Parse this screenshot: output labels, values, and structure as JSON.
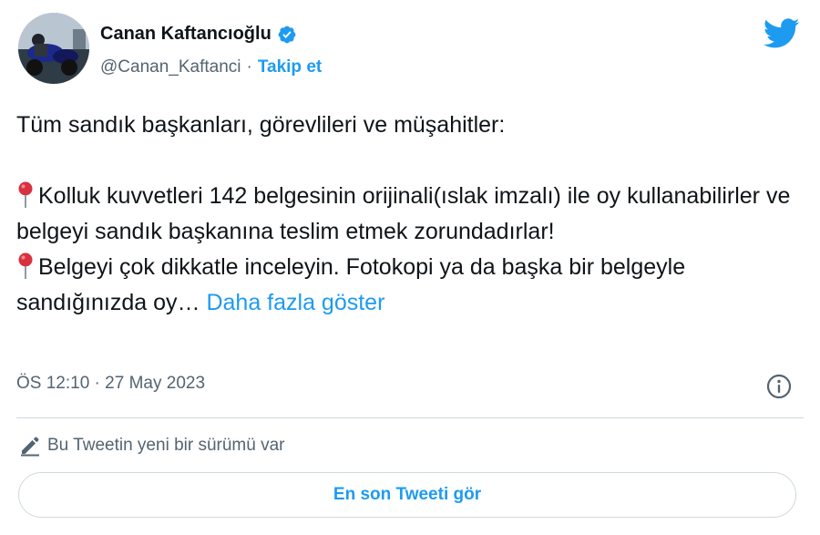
{
  "author": {
    "display_name": "Canan Kaftancıoğlu",
    "handle": "@Canan_Kaftanci",
    "separator": "·",
    "follow_label": "Takip et"
  },
  "icons": {
    "verified": "verified-badge-icon",
    "brand": "twitter-bird-icon",
    "pin": "round-pushpin-icon",
    "info": "info-icon",
    "edit": "pencil-icon"
  },
  "colors": {
    "accent": "#1d9bf0",
    "text": "#0f1419",
    "secondary": "#536471",
    "border": "#cfd9de",
    "pin_red": "#d9313f"
  },
  "tweet": {
    "line1": "Tüm sandık başkanları, görevlileri ve müşahitler:",
    "para2": "Kolluk kuvvetleri 142 belgesinin orijinali(ıslak imzalı) ile oy kullanabilirler ve belgeyi sandık başkanına teslim etmek zorundadırlar!",
    "para3": "Belgeyi çok dikkatle inceleyin. Fotokopi ya da başka bir belgeyle sandığınızda oy…",
    "show_more": "Daha fazla göster"
  },
  "meta": {
    "timestamp": "ÖS 12:10 · 27 May 2023"
  },
  "edit_notice": {
    "text": "Bu Tweetin yeni bir sürümü var",
    "button_label": "En son Tweeti gör"
  }
}
